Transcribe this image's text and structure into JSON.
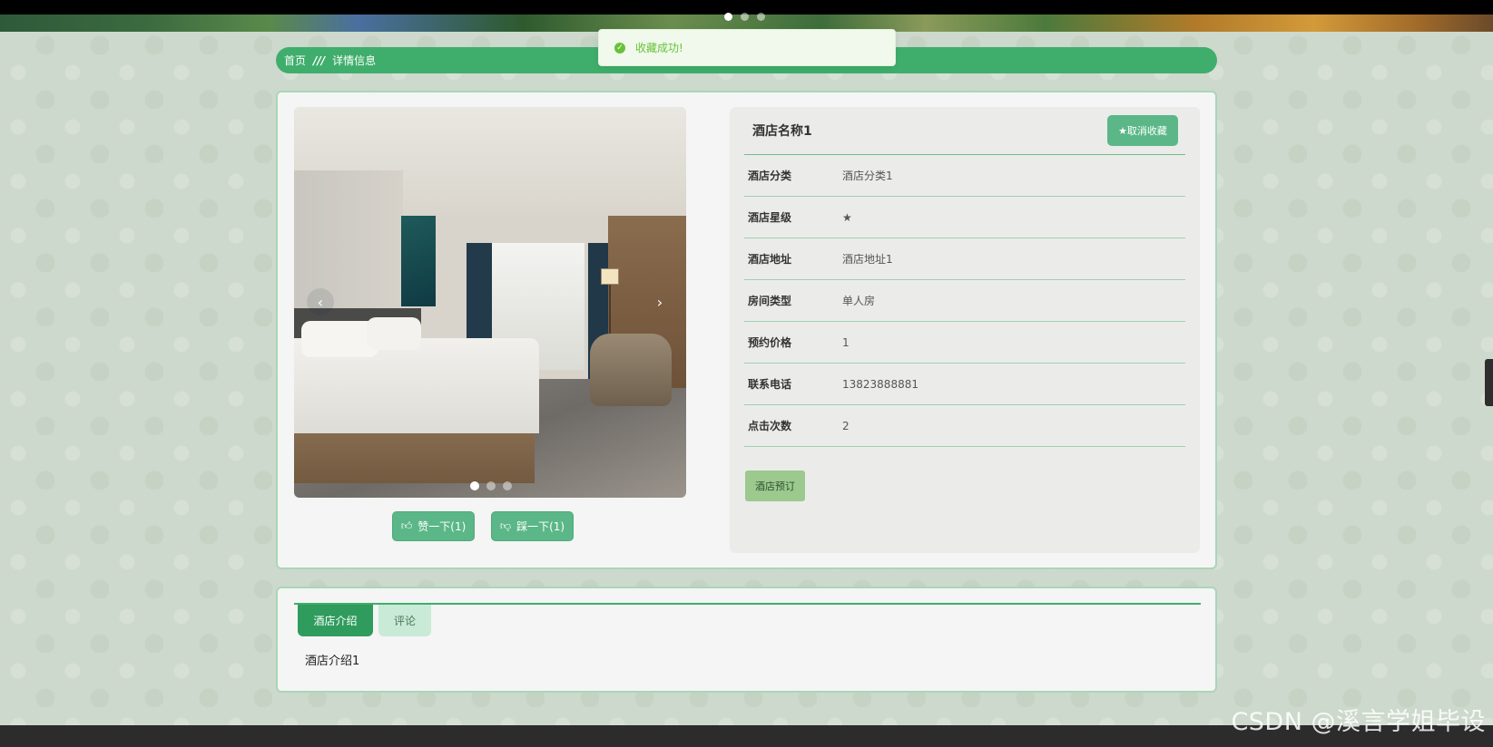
{
  "toast": {
    "message": "收藏成功!"
  },
  "breadcrumb": {
    "home": "首页",
    "separator": "///",
    "current": "详情信息"
  },
  "hotel": {
    "name": "酒店名称1",
    "fav_button": "★取消收藏",
    "fields": [
      {
        "label": "酒店分类",
        "value": "酒店分类1"
      },
      {
        "label": "酒店星级",
        "value": "★"
      },
      {
        "label": "酒店地址",
        "value": "酒店地址1"
      },
      {
        "label": "房间类型",
        "value": "单人房"
      },
      {
        "label": "预约价格",
        "value": "1"
      },
      {
        "label": "联系电话",
        "value": "13823888881"
      },
      {
        "label": "点击次数",
        "value": "2"
      }
    ],
    "book_button": "酒店预订"
  },
  "gallery": {
    "prev": "‹",
    "next": "›",
    "slide_count": 3,
    "active_slide": 1
  },
  "votes": {
    "like": "赞一下(1)",
    "dislike": "踩一下(1)"
  },
  "tabs": [
    {
      "label": "酒店介绍",
      "active": true
    },
    {
      "label": "评论",
      "active": false
    }
  ],
  "intro": "酒店介绍1",
  "watermark": "CSDN @溪言学姐毕设",
  "colors": {
    "accent": "#3fae6c",
    "button": "#5bb787",
    "book": "#9bc98e",
    "success": "#67c23a"
  }
}
